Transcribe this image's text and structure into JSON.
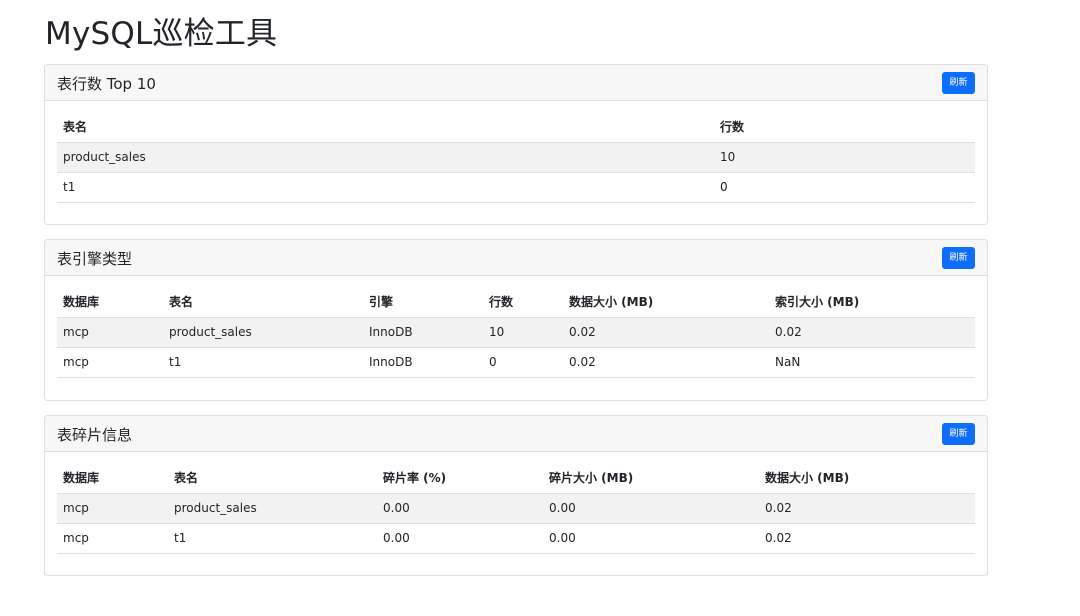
{
  "app": {
    "title": "MySQL巡检工具"
  },
  "refresh_label": "刷新",
  "top10": {
    "title": "表行数 Top 10",
    "headers": [
      "表名",
      "行数"
    ],
    "rows": [
      [
        "product_sales",
        "10"
      ],
      [
        "t1",
        "0"
      ]
    ]
  },
  "engine": {
    "title": "表引擎类型",
    "headers": [
      "数据库",
      "表名",
      "引擎",
      "行数",
      "数据大小 (MB)",
      "索引大小 (MB)"
    ],
    "rows": [
      [
        "mcp",
        "product_sales",
        "InnoDB",
        "10",
        "0.02",
        "0.02"
      ],
      [
        "mcp",
        "t1",
        "InnoDB",
        "0",
        "0.02",
        "NaN"
      ]
    ]
  },
  "fragment": {
    "title": "表碎片信息",
    "headers": [
      "数据库",
      "表名",
      "碎片率 (%)",
      "碎片大小 (MB)",
      "数据大小 (MB)"
    ],
    "rows": [
      [
        "mcp",
        "product_sales",
        "0.00",
        "0.00",
        "0.02"
      ],
      [
        "mcp",
        "t1",
        "0.00",
        "0.00",
        "0.02"
      ]
    ]
  },
  "colors": {
    "accent": "#0d6efd",
    "header_bg": "#f7f7f7",
    "stripe": "#f2f2f2",
    "border": "#dcdfe3"
  }
}
